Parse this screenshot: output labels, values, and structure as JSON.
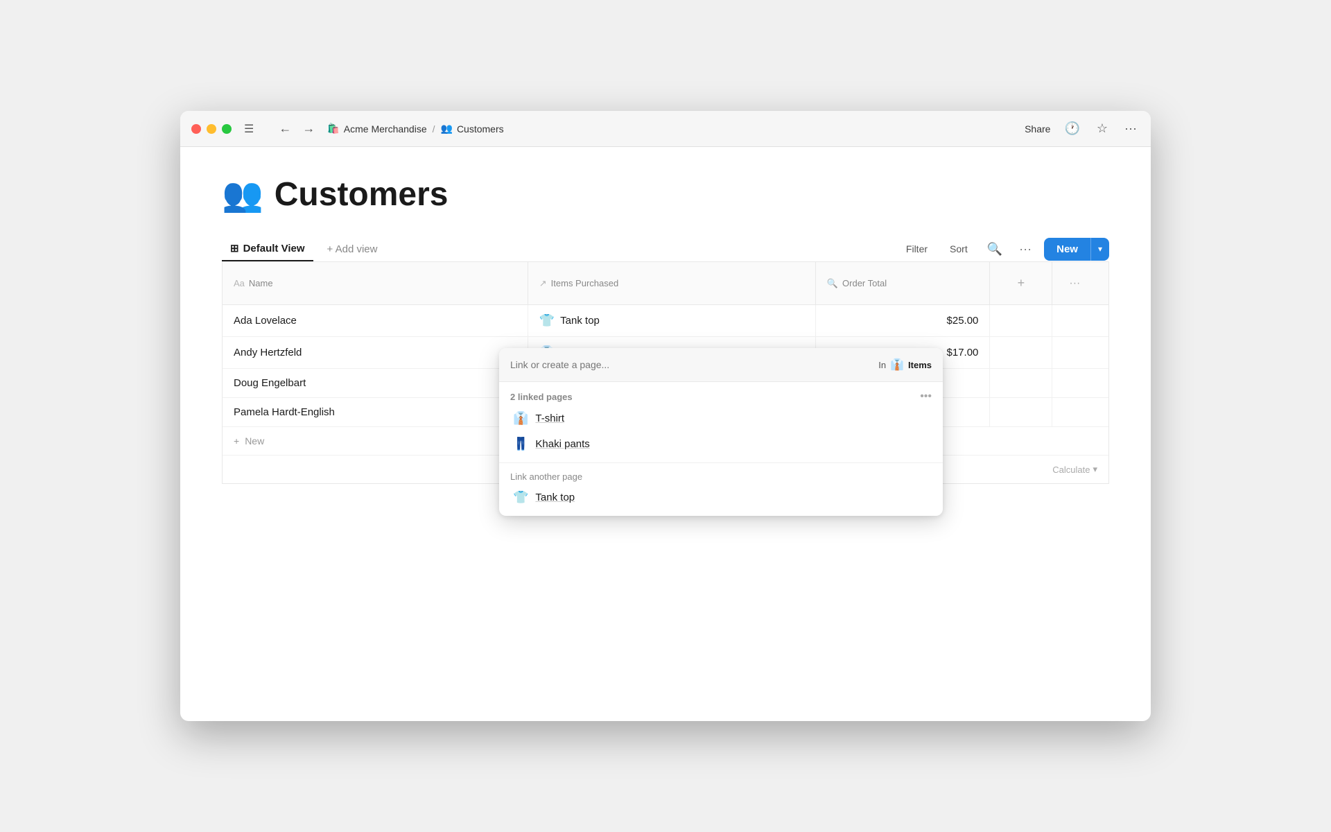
{
  "window": {
    "title": "Acme Merchandise — Customers"
  },
  "titlebar": {
    "breadcrumb_icon_app": "🛍️",
    "breadcrumb_app": "Acme Merchandise",
    "breadcrumb_sep": "/",
    "breadcrumb_icon_page": "👥",
    "breadcrumb_page": "Customers",
    "share_label": "Share",
    "history_icon": "🕐",
    "star_icon": "☆",
    "more_icon": "···"
  },
  "page": {
    "icon": "👥",
    "title": "Customers"
  },
  "toolbar": {
    "view_icon": "⊞",
    "view_label": "Default View",
    "add_view_label": "+ Add view",
    "filter_label": "Filter",
    "sort_label": "Sort",
    "search_icon": "🔍",
    "more_icon": "···",
    "new_label": "New"
  },
  "table": {
    "columns": [
      {
        "icon": "Aa",
        "label": "Name"
      },
      {
        "icon": "↗",
        "label": "Items Purchased"
      },
      {
        "icon": "🔍",
        "label": "Order Total"
      }
    ],
    "rows": [
      {
        "name": "Ada Lovelace",
        "item_icon": "👕",
        "item": "Tank top",
        "total": "$25.00"
      },
      {
        "name": "Andy Hertzfeld",
        "item_icon": "👔",
        "item": "T-shirt",
        "total": "$17.00"
      },
      {
        "name": "Doug Engelbart",
        "item_icon": "",
        "item": "",
        "total": ""
      },
      {
        "name": "Pamela Hardt-English",
        "item_icon": "",
        "item": "",
        "total": ""
      }
    ],
    "new_row_label": "New",
    "calculate_label": "Calculate",
    "calculate_icon": "▾"
  },
  "popup": {
    "search_placeholder": "Link or create a page...",
    "in_label": "In",
    "in_icon": "👔",
    "in_text": "Items",
    "linked_section_title": "2 linked pages",
    "more_icon": "•••",
    "linked_items": [
      {
        "icon": "👔",
        "label": "T-shirt"
      },
      {
        "icon": "👖",
        "label": "Khaki pants"
      }
    ],
    "link_another_label": "Link another page",
    "suggestion_items": [
      {
        "icon": "👕",
        "label": "Tank top"
      }
    ]
  }
}
